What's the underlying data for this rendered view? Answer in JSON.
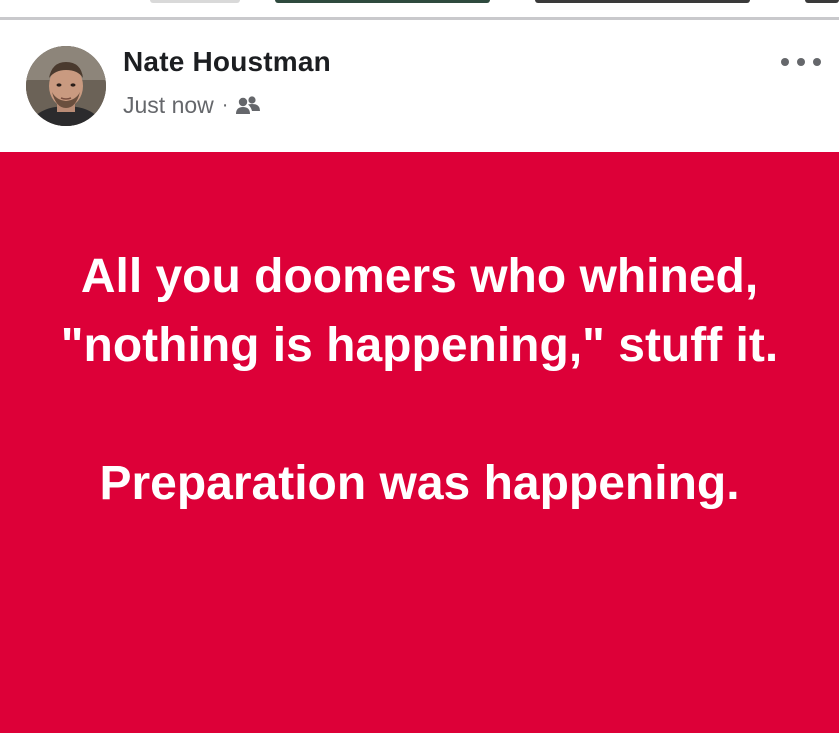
{
  "post": {
    "author": "Nate Houstman",
    "timestamp": "Just now",
    "separator": "·",
    "audience_icon": "friends-icon",
    "menu_icon": "more-options-icon",
    "background_color": "#dd0038",
    "text_color": "#ffffff",
    "paragraphs": [
      "All you doomers who whined, \"nothing is happening,\" stuff it.",
      "Preparation was happening."
    ]
  }
}
